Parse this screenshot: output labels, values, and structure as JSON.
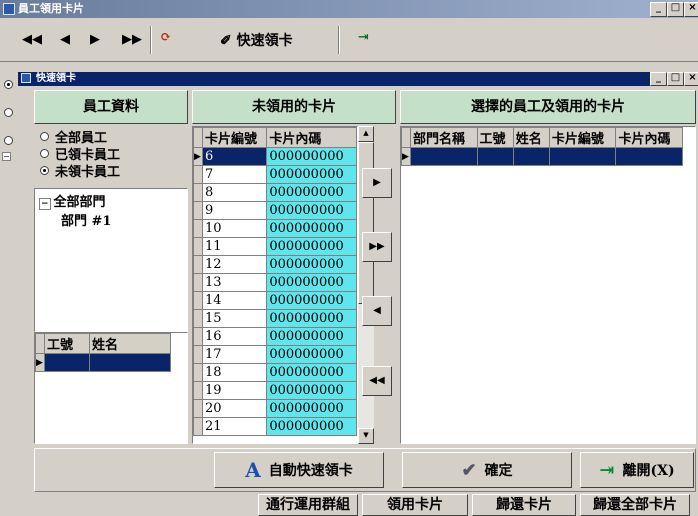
{
  "window": {
    "title": "員工領用卡片"
  },
  "toolbar": {
    "first": "◀◀",
    "prev": "◀",
    "next": "▶",
    "last": "▶▶",
    "quick_label": "快速領卡"
  },
  "dialog": {
    "title": "快速領卡"
  },
  "left": {
    "header": "員工資料",
    "radios": [
      "全部員工",
      "已領卡員工",
      "未領卡員工"
    ],
    "tree_root": "全部部門",
    "tree_child": "部門 #1",
    "grid_cols": [
      "工號",
      "姓名"
    ]
  },
  "middle": {
    "header": "未領用的卡片",
    "cols": [
      "卡片編號",
      "卡片內碼"
    ],
    "rows": [
      {
        "no": "6",
        "code": "000000000"
      },
      {
        "no": "7",
        "code": "000000000"
      },
      {
        "no": "8",
        "code": "000000000"
      },
      {
        "no": "9",
        "code": "000000000"
      },
      {
        "no": "10",
        "code": "000000000"
      },
      {
        "no": "11",
        "code": "000000000"
      },
      {
        "no": "12",
        "code": "000000000"
      },
      {
        "no": "13",
        "code": "000000000"
      },
      {
        "no": "14",
        "code": "000000000"
      },
      {
        "no": "15",
        "code": "000000000"
      },
      {
        "no": "16",
        "code": "000000000"
      },
      {
        "no": "17",
        "code": "000000000"
      },
      {
        "no": "18",
        "code": "000000000"
      },
      {
        "no": "19",
        "code": "000000000"
      },
      {
        "no": "20",
        "code": "000000000"
      },
      {
        "no": "21",
        "code": "000000000"
      }
    ]
  },
  "right": {
    "header": "選擇的員工及領用的卡片",
    "cols": [
      "部門名稱",
      "工號",
      "姓名",
      "卡片編號",
      "卡片內碼"
    ]
  },
  "actions": {
    "auto": "自動快速領卡",
    "ok": "確定",
    "exit": "離開(X)"
  },
  "bottom": [
    "通行運用群組",
    "領用卡片",
    "歸還卡片",
    "歸還全部卡片"
  ]
}
